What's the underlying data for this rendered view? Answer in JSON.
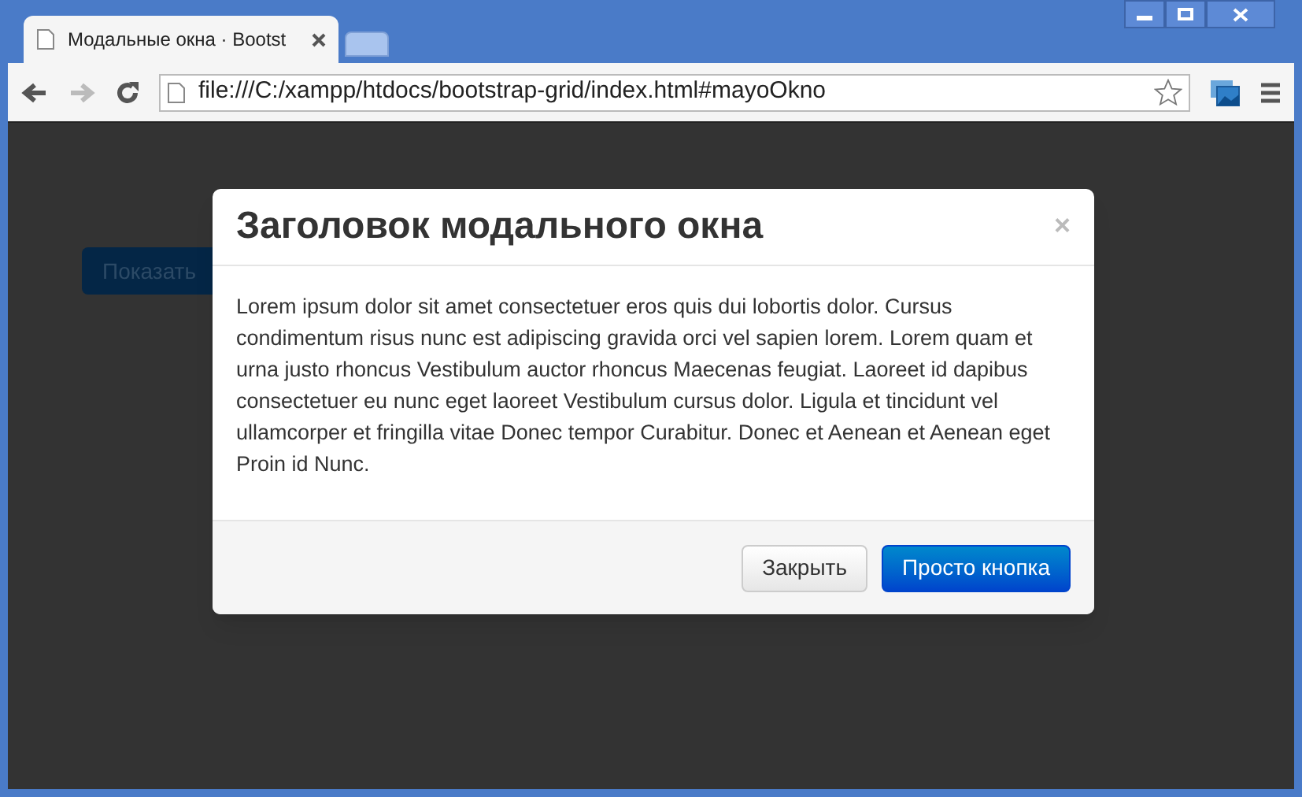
{
  "browser": {
    "tab_title": "Модальные окна · Bootst",
    "url": "file:///C:/xampp/htdocs/bootstrap-grid/index.html#mayoOkno"
  },
  "page": {
    "button": "Показать"
  },
  "modal": {
    "title": "Заголовок модального окна",
    "close": "×",
    "body": "Lorem ipsum dolor sit amet consectetuer eros quis dui lobortis dolor. Cursus condimentum risus nunc est adipiscing gravida orci vel sapien lorem. Lorem quam et urna justo rhoncus Vestibulum auctor rhoncus Maecenas feugiat. Laoreet id dapibus consectetuer eu nunc eget laoreet Vestibulum cursus dolor. Ligula et tincidunt vel ullamcorper et fringilla vitae Donec tempor Curabitur. Donec et Aenean et Aenean eget Proin id Nunc.",
    "buttons": [
      {
        "label": "Закрыть",
        "kind": "default"
      },
      {
        "label": "Просто кнопка",
        "kind": "primary"
      }
    ]
  }
}
